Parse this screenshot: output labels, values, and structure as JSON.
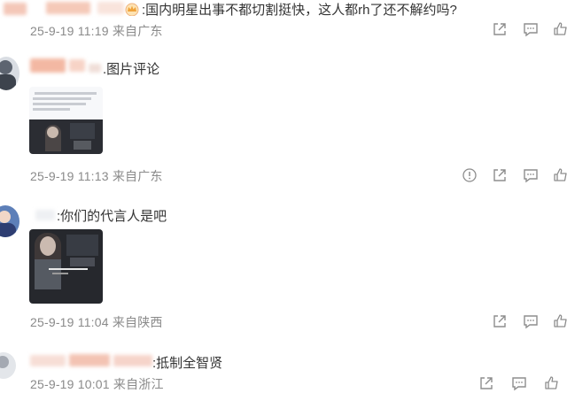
{
  "comments": [
    {
      "text": ":国内明星出事不都切割挺快，这人都rh了还不解约吗?",
      "meta": "25-9-19 11:19 来自广东"
    },
    {
      "text": ".图片评论",
      "meta": "25-9-19 11:13 来自广东",
      "image_caption": "图片评论截图"
    },
    {
      "text": ":你们的代言人是吧",
      "meta": "25-9-19 11:04 来自陕西",
      "image_caption": "视频截图"
    },
    {
      "text": ":抵制全智贤",
      "meta": "25-9-19 10:01 来自浙江"
    }
  ],
  "icons": [
    "crown-icon",
    "share-icon",
    "comment-icon",
    "like-icon",
    "report-icon"
  ],
  "colors": {
    "text": "#333333",
    "meta": "#8a8a8a",
    "icon": "#8d8d8d",
    "accent": "#f0b37e"
  }
}
